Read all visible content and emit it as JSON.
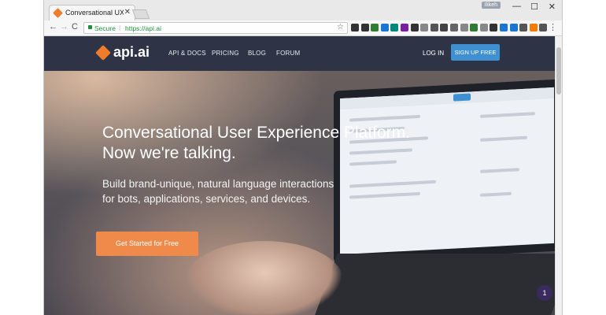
{
  "browser": {
    "tab_title": "Conversational UX Platf",
    "tab_close": "✕",
    "user_badge": "Ilikeh",
    "window_min": "—",
    "window_max": "☐",
    "window_close": "✕",
    "back": "←",
    "forward": "→",
    "reload": "C",
    "secure_label": "Secure",
    "separator": "|",
    "url": "https://api.ai",
    "star": "☆",
    "menu": "⋮",
    "extension_colors": [
      "#333333",
      "#333333",
      "#2e7d32",
      "#1976d2",
      "#00897b",
      "#7b1fa2",
      "#333333",
      "#888888",
      "#555555",
      "#444444",
      "#666666",
      "#888888",
      "#2e7d32",
      "#888888",
      "#333333",
      "#1976d2",
      "#1976d2",
      "#555555",
      "#f57c00",
      "#555555"
    ]
  },
  "site": {
    "logo_text": "api.ai",
    "nav": [
      "API & DOCS",
      "PRICING",
      "BLOG",
      "FORUM"
    ],
    "login": "LOG IN",
    "signup": "SIGN UP FREE",
    "headline_line1": "Conversational User Experience Platform.",
    "headline_line2": "Now we're talking.",
    "subtext_line1": "Build brand-unique, natural language interactions",
    "subtext_line2": "for bots, applications, services, and devices.",
    "cta": "Get Started for Free",
    "chat_count": "1"
  },
  "colors": {
    "nav_bg": "#2e3446",
    "accent_orange": "#ef7c2a",
    "cta_orange": "#f08a4b",
    "signup_blue": "#3e90d0"
  }
}
